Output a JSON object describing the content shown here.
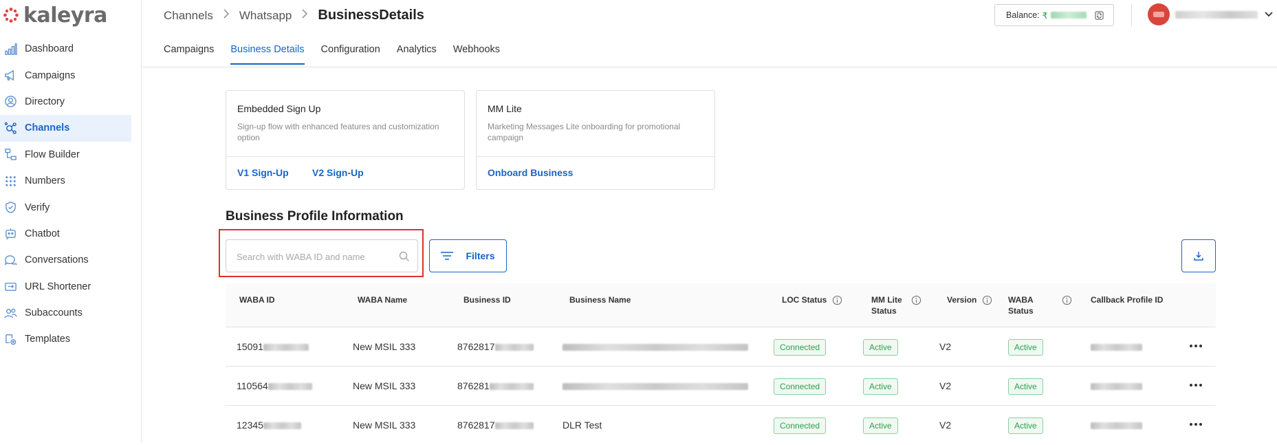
{
  "brand": {
    "name": "kaleyra"
  },
  "sidebar": {
    "items": [
      {
        "label": "Dashboard",
        "icon": "bar-chart-icon"
      },
      {
        "label": "Campaigns",
        "icon": "megaphone-icon"
      },
      {
        "label": "Directory",
        "icon": "contact-icon"
      },
      {
        "label": "Channels",
        "icon": "channels-icon",
        "active": true
      },
      {
        "label": "Flow Builder",
        "icon": "flow-icon"
      },
      {
        "label": "Numbers",
        "icon": "dialpad-icon"
      },
      {
        "label": "Verify",
        "icon": "shield-check-icon"
      },
      {
        "label": "Chatbot",
        "icon": "bot-icon"
      },
      {
        "label": "Conversations",
        "icon": "chat-bubbles-icon"
      },
      {
        "label": "URL Shortener",
        "icon": "link-icon"
      },
      {
        "label": "Subaccounts",
        "icon": "users-icon"
      },
      {
        "label": "Templates",
        "icon": "template-gear-icon"
      }
    ]
  },
  "header": {
    "breadcrumb": [
      "Channels",
      "Whatsapp",
      "BusinessDetails"
    ],
    "balance_label": "Balance:",
    "balance_currency": "₹",
    "tabs": [
      "Campaigns",
      "Business Details",
      "Configuration",
      "Analytics",
      "Webhooks"
    ],
    "active_tab": 1
  },
  "cards": [
    {
      "title": "Embedded Sign Up",
      "description": "Sign-up flow with enhanced features and customization option",
      "links": [
        "V1 Sign-Up",
        "V2 Sign-Up"
      ]
    },
    {
      "title": "MM Lite",
      "description": "Marketing Messages Lite onboarding for promotional campaign",
      "links": [
        "Onboard Business"
      ]
    }
  ],
  "profile": {
    "title": "Business Profile Information",
    "search_placeholder": "Search with WABA ID and name",
    "search_value": "",
    "filters_label": "Filters"
  },
  "table": {
    "columns": [
      {
        "label": "WABA ID"
      },
      {
        "label": "WABA Name"
      },
      {
        "label": "Business ID"
      },
      {
        "label": "Business Name"
      },
      {
        "label": "LOC Status",
        "info": true
      },
      {
        "label": "MM Lite Status",
        "info": true
      },
      {
        "label": "Version",
        "info": true
      },
      {
        "label": "WABA Status",
        "info": true
      },
      {
        "label": "Callback Profile ID"
      }
    ],
    "rows": [
      {
        "waba_id": "15091",
        "waba_name": "New MSIL 333",
        "business_id": "8762817",
        "business_name": "",
        "loc_status": "Connected",
        "mm_lite_status": "Active",
        "version": "V2",
        "waba_status": "Active"
      },
      {
        "waba_id": "110564",
        "waba_name": "New MSIL 333",
        "business_id": "876281",
        "business_name": "",
        "loc_status": "Connected",
        "mm_lite_status": "Active",
        "version": "V2",
        "waba_status": "Active"
      },
      {
        "waba_id": "12345",
        "waba_name": "New MSIL 333",
        "business_id": "8762817",
        "business_name": "DLR Test",
        "loc_status": "Connected",
        "mm_lite_status": "Active",
        "version": "V2",
        "waba_status": "Active"
      }
    ]
  },
  "colors": {
    "accent": "#1565c8",
    "success": "#2e9e4f",
    "highlight": "#d9322f"
  }
}
